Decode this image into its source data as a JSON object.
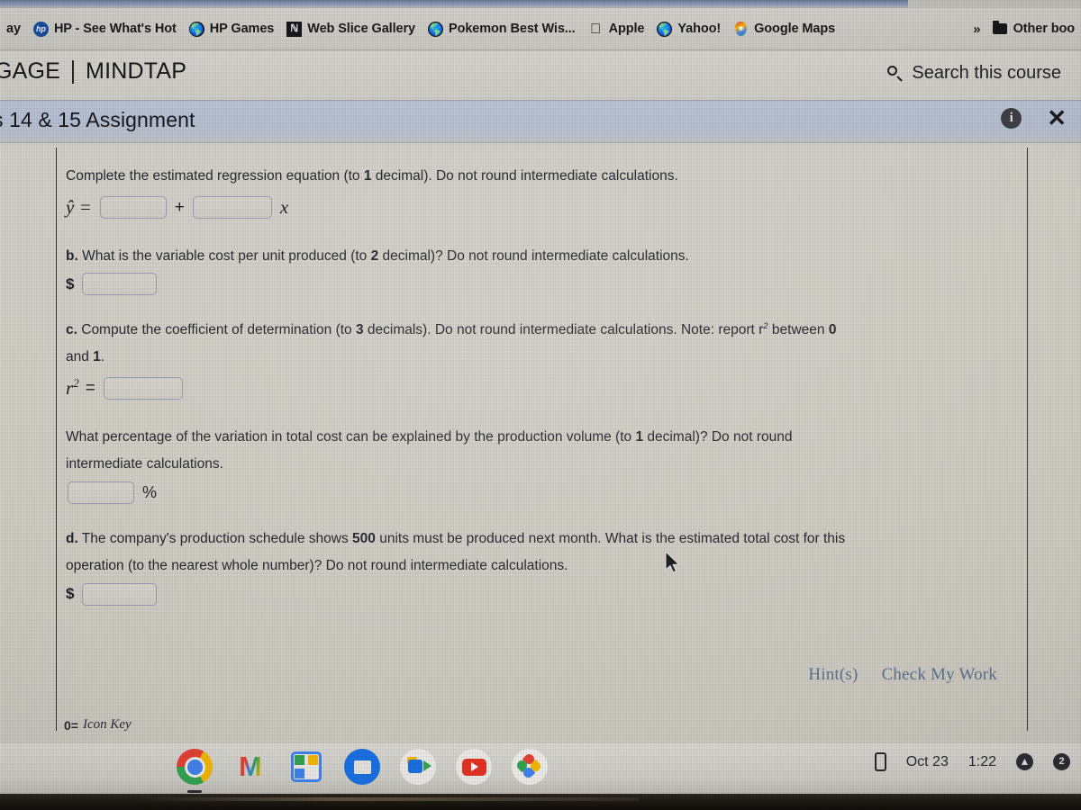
{
  "browser": {
    "bookmarks": [
      {
        "label": "ay",
        "icon": "globe-icon",
        "icon_kind": "none"
      },
      {
        "label": "HP - See What's Hot",
        "icon": "hp-logo-icon",
        "icon_kind": "hp"
      },
      {
        "label": "HP Games",
        "icon": "globe-icon",
        "icon_kind": "globe"
      },
      {
        "label": "Web Slice Gallery",
        "icon": "web-slice-icon",
        "icon_kind": "webslice"
      },
      {
        "label": "Pokemon Best Wis...",
        "icon": "globe-icon",
        "icon_kind": "globe"
      },
      {
        "label": "Apple",
        "icon": "apple-logo-icon",
        "icon_kind": "apple"
      },
      {
        "label": "Yahoo!",
        "icon": "globe-icon",
        "icon_kind": "globe"
      },
      {
        "label": "Google Maps",
        "icon": "map-pin-icon",
        "icon_kind": "pin"
      }
    ],
    "overflow_label": "»",
    "other_bookmarks_label": "Other boo"
  },
  "header": {
    "brand_left": "GAGE",
    "brand_right": "MINDTAP",
    "search_label": "Search this course",
    "search_icon": "search-icon"
  },
  "assignment": {
    "title": "s 14 & 15 Assignment",
    "info_glyph": "i",
    "close_glyph": "✕"
  },
  "question": {
    "part_a": {
      "prompt_1": "Complete the estimated regression equation (to ",
      "prompt_decimal": "1",
      "prompt_2": " decimal). Do not round intermediate calculations.",
      "eq_lhs": "ŷ =",
      "eq_plus": "+",
      "eq_var": "x",
      "input_1_value": "",
      "input_2_value": ""
    },
    "part_b": {
      "label": "b.",
      "text_1": " What is the variable cost per unit produced (to ",
      "decimal": "2",
      "text_2": " decimal)? Do not round intermediate calculations.",
      "currency": "$",
      "input_value": ""
    },
    "part_c": {
      "label": "c.",
      "text_1": " Compute the coefficient of determination (to ",
      "decimal": "3",
      "text_2": " decimals). Do not round intermediate calculations. Note: report r",
      "sup": "2",
      "text_3": " between ",
      "zero": "0",
      "line2_a": "and ",
      "line2_one": "1",
      "line2_b": ".",
      "eq_lhs": "r",
      "eq_sup": "2",
      "eq_eq": "=",
      "input_value": ""
    },
    "percentage": {
      "text_1": "What percentage of the variation in total cost can be explained by the production volume (to ",
      "decimal": "1",
      "text_2": " decimal)? Do not round",
      "line2": "intermediate calculations.",
      "unit": "%",
      "input_value": ""
    },
    "part_d": {
      "label": "d.",
      "text_1": " The company's production schedule shows ",
      "units": "500",
      "text_2": " units must be produced next month. What is the estimated total cost for this",
      "line2": "operation (to the nearest whole number)? Do not round intermediate calculations.",
      "currency": "$",
      "input_value": ""
    },
    "links": {
      "hints": "Hint(s)",
      "check_my_work": "Check My Work"
    },
    "icon_key": {
      "glyph": "0=",
      "label": "Icon Key"
    }
  },
  "shelf": {
    "apps": [
      {
        "name": "chrome-app",
        "label": "Chrome"
      },
      {
        "name": "gmail-app",
        "label": "Gmail",
        "glyph": "M"
      },
      {
        "name": "docs-app",
        "label": "Docs"
      },
      {
        "name": "files-app",
        "label": "Files"
      },
      {
        "name": "meet-app",
        "label": "Meet"
      },
      {
        "name": "youtube-app",
        "label": "YouTube"
      },
      {
        "name": "photos-app",
        "label": "Photos"
      }
    ],
    "status": {
      "phone_icon": "phone-icon",
      "date": "Oct 23",
      "time": "1:22",
      "update_glyph": "▲",
      "account_glyph": "2"
    }
  },
  "colors": {
    "panel_bg": "#d4d1c7",
    "title_bar": "#bcc5d7",
    "link_blue": "#5c7590",
    "text": "#21242c",
    "input_border": "#9aa0b5"
  }
}
